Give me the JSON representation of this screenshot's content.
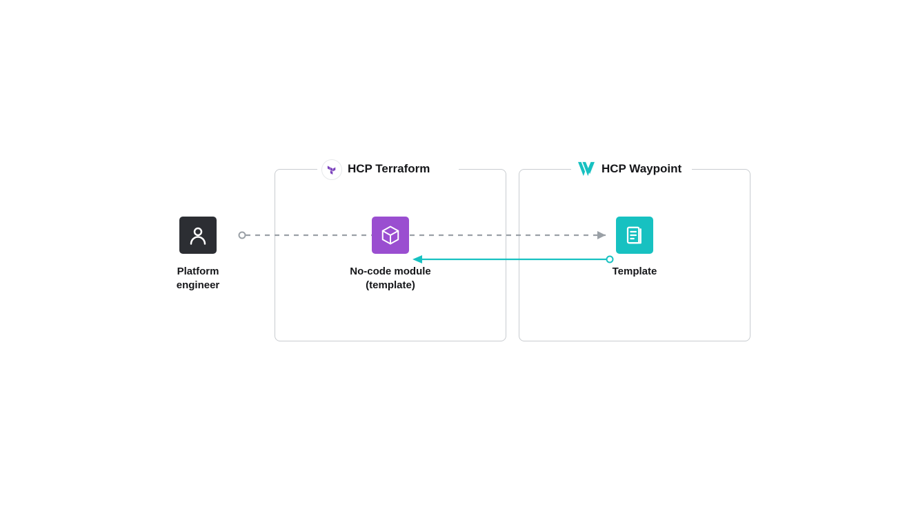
{
  "actors": {
    "platform_engineer": {
      "label_line1": "Platform",
      "label_line2": "engineer"
    }
  },
  "groups": {
    "terraform": {
      "title": "HCP Terraform",
      "node_module": {
        "label_line1": "No-code module",
        "label_line2": "(template)"
      }
    },
    "waypoint": {
      "title": "HCP Waypoint",
      "node_template": {
        "label": "Template"
      }
    }
  },
  "colors": {
    "box_border": "#c8ccd0",
    "connector_gray": "#9aa0a6",
    "connector_teal": "#17c1c1",
    "person_bg": "#2c2e33",
    "module_bg": "#9a4ed0",
    "template_bg": "#17c1c1",
    "terraform_brand": "#7b42bc"
  }
}
